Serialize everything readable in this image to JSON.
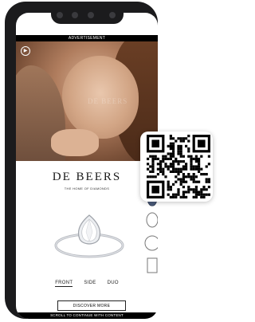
{
  "ad_banner": {
    "label": "ADVERTISEMENT"
  },
  "hero": {
    "watermark": "DE BEERS",
    "play_icon": "play-icon"
  },
  "brand": {
    "name": "DE BEERS",
    "tagline": "THE HOME OF DIAMONDS"
  },
  "view_tabs": [
    {
      "label": "FRONT",
      "active": true
    },
    {
      "label": "SIDE",
      "active": false
    },
    {
      "label": "DUO",
      "active": false
    }
  ],
  "cta": {
    "label": "DISCOVER MORE"
  },
  "footer": {
    "label": "SCROLL TO CONTINUE WITH CONTENT"
  },
  "shape_selector": [
    "pear-shape-icon",
    "oval-shape-icon",
    "round-shape-icon",
    "emerald-shape-icon"
  ],
  "colors": {
    "device": "#1b1b1d",
    "accent": "#000000",
    "selected_shape": "#4a5a7a"
  }
}
